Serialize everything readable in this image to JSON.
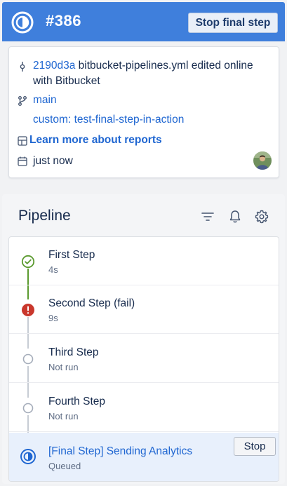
{
  "header": {
    "run_number": "#386",
    "stop_final_label": "Stop final step",
    "accent_color": "#3f7fdc"
  },
  "details": {
    "commit_hash": "2190d3a",
    "commit_message": " bitbucket-pipelines.yml edited online with Bitbucket",
    "branch": "main",
    "pipeline_name": "custom: test-final-step-in-action",
    "reports_link": "Learn more about reports",
    "time": "just now",
    "icons": [
      "commit-icon",
      "branch-icon",
      "reports-icon",
      "calendar-icon",
      "avatar"
    ]
  },
  "pipeline": {
    "title": "Pipeline",
    "header_icons": [
      "filter-icon",
      "bell-icon",
      "gear-icon"
    ],
    "steps": [
      {
        "name": "First Step",
        "sub": "4s",
        "status": "success"
      },
      {
        "name": "Second Step (fail)",
        "sub": "9s",
        "status": "failed"
      },
      {
        "name": "Third Step",
        "sub": "Not run",
        "status": "not-run"
      },
      {
        "name": "Fourth Step",
        "sub": "Not run",
        "status": "not-run"
      },
      {
        "name": "[Final Step] Sending Analytics",
        "sub": "Queued",
        "status": "queued",
        "action_label": "Stop"
      }
    ],
    "colors": {
      "success": "#5b9a2f",
      "failed": "#c9372c",
      "not_run": "#a5adba",
      "link": "#1f66d1"
    }
  }
}
